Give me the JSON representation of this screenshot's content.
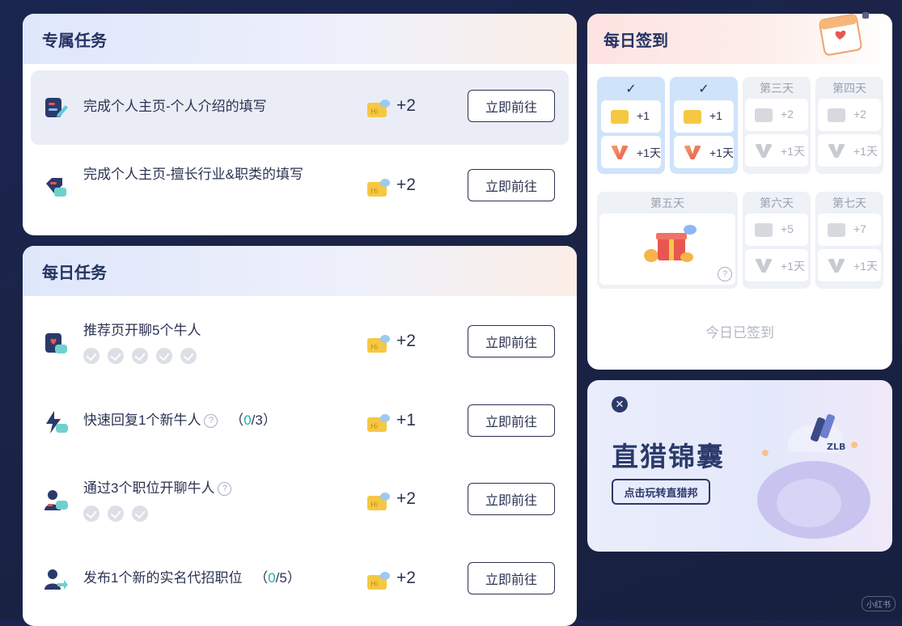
{
  "exclusive": {
    "title": "专属任务",
    "tasks": [
      {
        "title": "完成个人主页-个人介绍的填写",
        "reward": "+2",
        "button": "立即前往"
      },
      {
        "title": "完成个人主页-擅长行业&职类的填写",
        "reward": "+2",
        "button": "立即前往"
      }
    ]
  },
  "daily": {
    "title": "每日任务",
    "tasks": [
      {
        "title": "推荐页开聊5个牛人",
        "reward": "+2",
        "button": "立即前往",
        "checks": 5
      },
      {
        "title": "快速回复1个新牛人",
        "progress_open": "（",
        "progress_done": "0",
        "progress_total": "/3）",
        "reward": "+1",
        "button": "立即前往",
        "help": "?"
      },
      {
        "title": "通过3个职位开聊牛人",
        "reward": "+2",
        "button": "立即前往",
        "checks": 3,
        "help": "?"
      },
      {
        "title": "发布1个新的实名代招职位",
        "progress_open": "（",
        "progress_done": "0",
        "progress_total": "/5）",
        "reward": "+2",
        "button": "立即前往"
      }
    ]
  },
  "checkin": {
    "title": "每日签到",
    "days": [
      {
        "label": "✓",
        "done": true,
        "rewards": [
          "+1",
          "+1天"
        ]
      },
      {
        "label": "✓",
        "done": true,
        "rewards": [
          "+1",
          "+1天"
        ]
      },
      {
        "label": "第三天",
        "done": false,
        "rewards": [
          "+2",
          "+1天"
        ]
      },
      {
        "label": "第四天",
        "done": false,
        "rewards": [
          "+2",
          "+1天"
        ]
      },
      {
        "label": "第五天",
        "done": false,
        "rewards": []
      },
      {
        "label": "第六天",
        "done": false,
        "rewards": [
          "+5",
          "+1天"
        ]
      },
      {
        "label": "第七天",
        "done": false,
        "rewards": [
          "+7",
          "+1天"
        ]
      }
    ],
    "status": "今日已签到",
    "help": "?"
  },
  "promo": {
    "title": "直猎锦囊",
    "button": "点击玩转直猎邦",
    "bag_text": "ZLB",
    "close": "✕"
  },
  "watermark": "小红书",
  "colors": {
    "accent": "#253262",
    "progress": "#1fb2a5",
    "done_day": "#cfe3fb"
  }
}
